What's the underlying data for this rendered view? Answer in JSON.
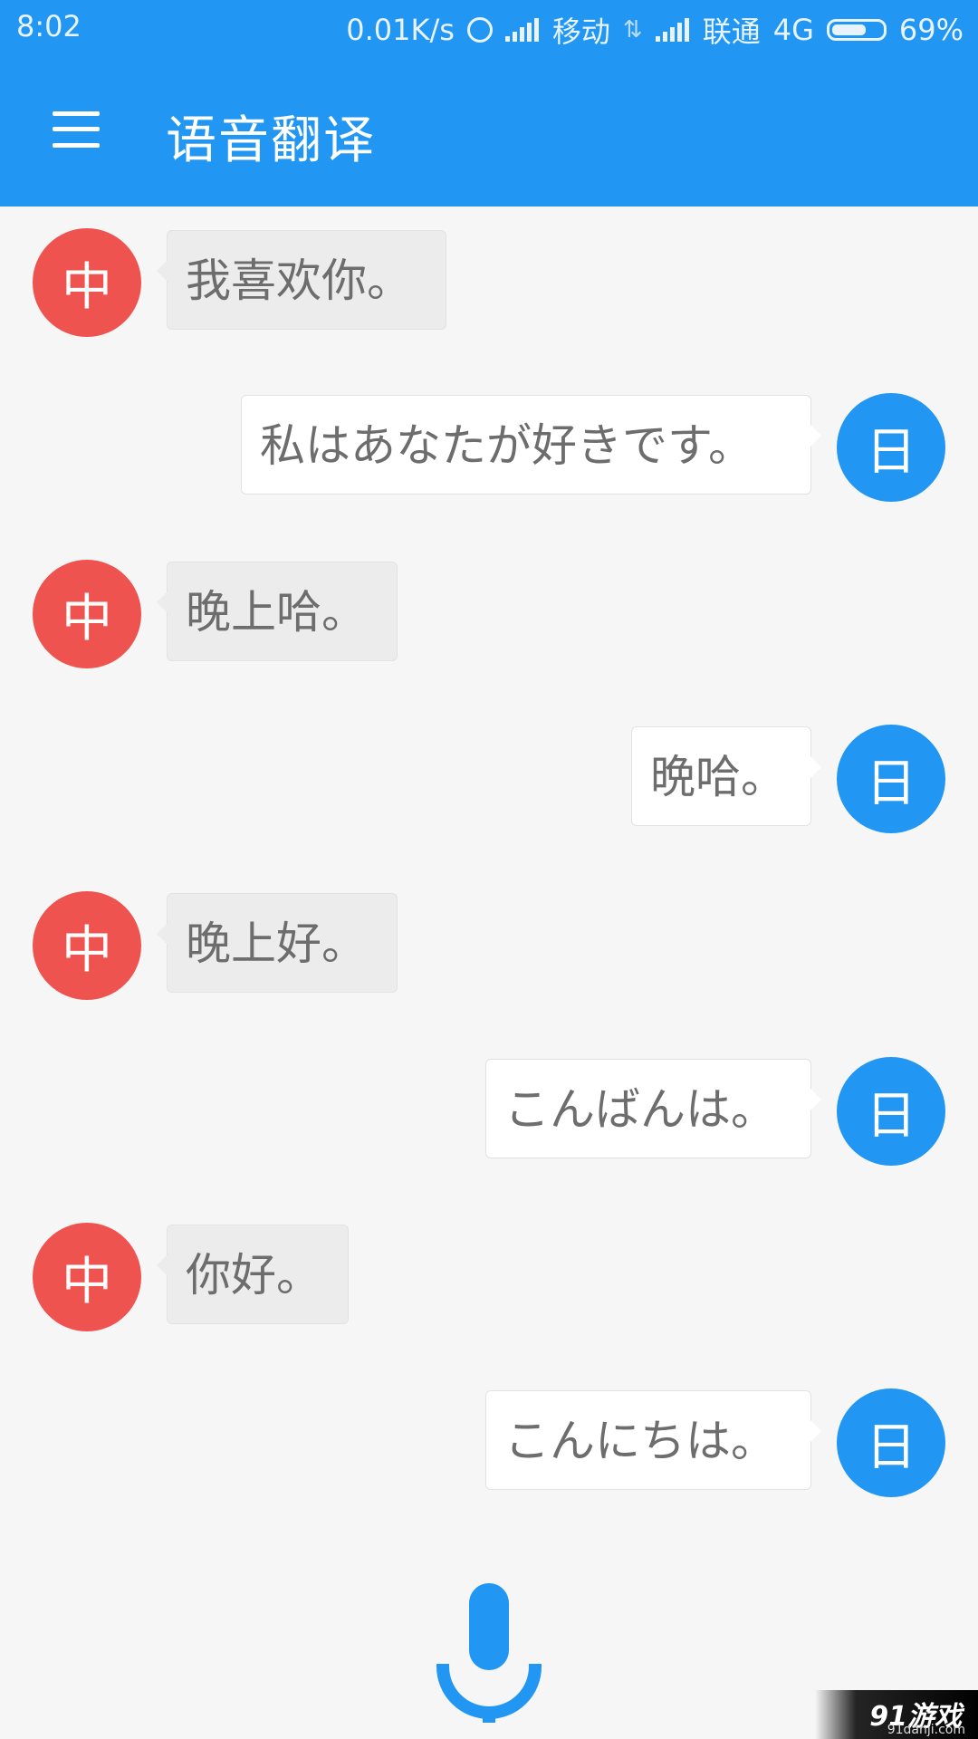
{
  "status_bar": {
    "time": "8:02",
    "speed": "0.01K/s",
    "carrier1": "移动",
    "carrier2": "联通",
    "network": "4G",
    "battery_percent": "69%",
    "battery_level": 0.69
  },
  "app_bar": {
    "title": "语音翻译",
    "menu_icon": "hamburger-menu-icon"
  },
  "messages": [
    {
      "lang": "zh",
      "avatar": "中",
      "text": "我喜欢你。"
    },
    {
      "lang": "ja",
      "avatar": "日",
      "text": "私はあなたが好きです。"
    },
    {
      "lang": "zh",
      "avatar": "中",
      "text": "晚上哈。"
    },
    {
      "lang": "ja",
      "avatar": "日",
      "text": "晩哈。"
    },
    {
      "lang": "zh",
      "avatar": "中",
      "text": "晚上好。"
    },
    {
      "lang": "ja",
      "avatar": "日",
      "text": "こんばんは。"
    },
    {
      "lang": "zh",
      "avatar": "中",
      "text": "你好。"
    },
    {
      "lang": "ja",
      "avatar": "日",
      "text": "こんにちは。"
    }
  ],
  "mic_button": {
    "icon": "microphone-icon"
  },
  "watermark": {
    "logo": "91游戏",
    "url": "91danji.com"
  },
  "colors": {
    "primary": "#2196f3",
    "zh_avatar": "#ef5350",
    "ja_avatar": "#2196f3",
    "zh_bubble": "#ececec",
    "ja_bubble": "#ffffff",
    "bubble_text": "#6d6d6d",
    "background": "#f6f6f6"
  }
}
